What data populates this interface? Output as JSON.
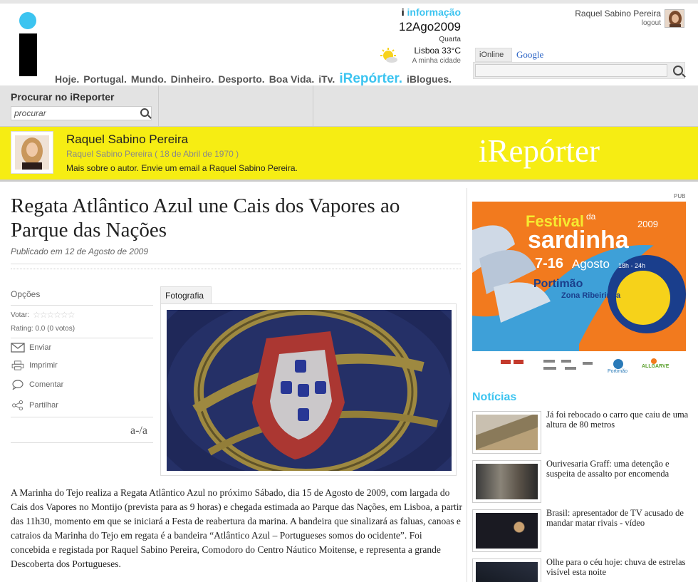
{
  "header": {
    "info_prefix": "i",
    "info_label": "informação",
    "date": "12Ago2009",
    "weekday": "Quarta",
    "weather": "Lisboa 33°C",
    "city_link": "A minha cidade",
    "user_name": "Raquel  Sabino Pereira",
    "logout": "logout",
    "nav": [
      "Hoje.",
      "Portugal.",
      "Mundo.",
      "Dinheiro.",
      "Desporto.",
      "Boa Vida.",
      "iTv."
    ],
    "nav_active": "iRepórter.",
    "nav_after": "iBlogues.",
    "search_tab_ionline": "iOnline",
    "search_tab_google": "Google"
  },
  "local_search": {
    "label": "Procurar no iReporter",
    "placeholder": "procurar"
  },
  "author": {
    "name": "Raquel Sabino Pereira",
    "sub": "Raquel Sabino Pereira ( 18 de Abril de 1970 )",
    "more": "Mais sobre o autor. Envie um email a Raquel Sabino Pereira.",
    "brand": "iRepórter"
  },
  "article": {
    "title": "Regata Atlântico Azul une Cais dos Vapores ao Parque das Nações",
    "published": "Publicado em 12 de Agosto de 2009",
    "body": "A Marinha do Tejo realiza a Regata Atlântico Azul no próximo Sábado, dia 15 de Agosto de 2009, com largada do Cais dos Vapores no Montijo (prevista para as 9 horas) e chegada estimada ao Parque das Nações, em Lisboa, a partir das 11h30, momento em que se iniciará a Festa de reabertura da marina. A bandeira que sinalizará as faluas, canoas e catraios da Marinha do Tejo em regata é a bandeira “Atlântico Azul – Portugueses somos do ocidente”. Foi concebida e registada por Raquel Sabino Pereira, Comodoro do Centro Náutico Moitense, e representa a grande Descoberta dos Portugueses."
  },
  "options": {
    "title": "Opções",
    "votar": "Votar:",
    "rating": "Rating: 0.0 (0 votos)",
    "items": [
      "Enviar",
      "Imprimir",
      "Comentar",
      "Partilhar"
    ],
    "fontsize": "a-/a"
  },
  "photo_tab": "Fotografia",
  "ad": {
    "pub": "PUB",
    "festival": "Festival",
    "da": "da",
    "sardinha": "sardinha",
    "year": "2009",
    "dates": "7-16",
    "month": "Agosto",
    "hours": "18h - 24h",
    "place": "Portimão",
    "zone": "Zona Ribeirinha",
    "portimao_logo": "Portimão",
    "allgarve": "ALLGARVE"
  },
  "news": {
    "title": "Notícias",
    "items": [
      "Já foi rebocado o carro que caiu de uma altura de 80 metros",
      "Ourivesaria Graff: uma detenção e suspeita de assalto por encomenda",
      "Brasil: apresentador de TV acusado de mandar matar rivais - vídeo",
      "Olhe para o céu hoje: chuva de estrelas visível esta noite"
    ]
  },
  "colors": {
    "accent": "#3cc4f0",
    "yellow": "#f6ed13"
  }
}
